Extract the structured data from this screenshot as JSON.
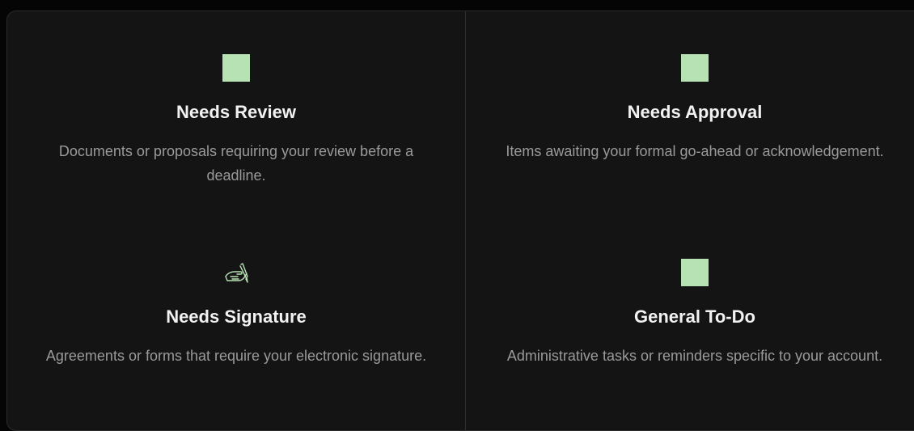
{
  "colors": {
    "background": "#050505",
    "panel": "#141414",
    "accent_icon": "#b6e2b4",
    "title": "#f2f2f2",
    "description": "#9a9a9a"
  },
  "cards": [
    {
      "icon": "green-square-icon",
      "title": "Needs Review",
      "description": "Documents or proposals requiring your review before a deadline."
    },
    {
      "icon": "green-square-icon",
      "title": "Needs Approval",
      "description": "Items awaiting your formal go-ahead or acknowledgement."
    },
    {
      "icon": "writing-hand-icon",
      "title": "Needs Signature",
      "description": "Agreements or forms that require your electronic signature."
    },
    {
      "icon": "green-square-icon",
      "title": "General To-Do",
      "description": "Administrative tasks or reminders specific to your account."
    }
  ]
}
